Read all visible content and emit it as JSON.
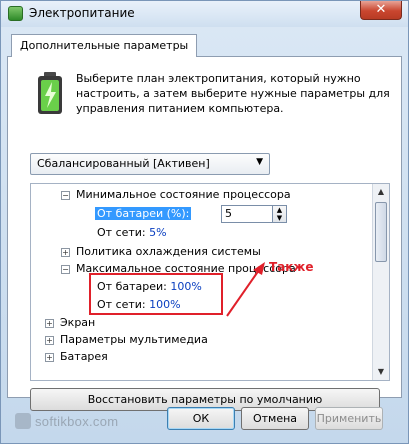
{
  "window": {
    "title": "Электропитание",
    "close_glyph": "✕"
  },
  "tab": {
    "label": "Дополнительные параметры"
  },
  "description": "Выберите план электропитания, который нужно настроить, а затем выберите нужные параметры для управления питанием компьютера.",
  "plan_select": {
    "value": "Сбалансированный [Активен]",
    "arrow": "▼"
  },
  "tree": {
    "min_state": {
      "expander": "−",
      "label": "Минимальное состояние процессора"
    },
    "min_battery": {
      "label": "От батареи (%):",
      "value": "5"
    },
    "min_ac": {
      "label": "От сети:",
      "value": "5%"
    },
    "cooling": {
      "expander": "+",
      "label": "Политика охлаждения системы"
    },
    "max_state": {
      "expander": "−",
      "label": "Максимальное состояние процессора"
    },
    "max_battery": {
      "label": "От батареи:",
      "value": "100%"
    },
    "max_ac": {
      "label": "От сети:",
      "value": "100%"
    },
    "screen": {
      "expander": "+",
      "label": "Экран"
    },
    "multimedia": {
      "expander": "+",
      "label": "Параметры мультимедиа"
    },
    "battery": {
      "expander": "+",
      "label": "Батарея"
    }
  },
  "spinner": {
    "up": "▲",
    "down": "▼"
  },
  "scrollbar": {
    "up": "▲",
    "down": "▼"
  },
  "annotation": "Также",
  "restore_button": "Восстановить параметры по умолчанию",
  "buttons": {
    "ok": "ОК",
    "cancel": "Отмена",
    "apply": "Применить"
  },
  "watermark": "softikbox.com",
  "colors": {
    "selection": "#3399ff",
    "annotation_red": "#e0202a",
    "value_blue": "#0a3fc0"
  }
}
